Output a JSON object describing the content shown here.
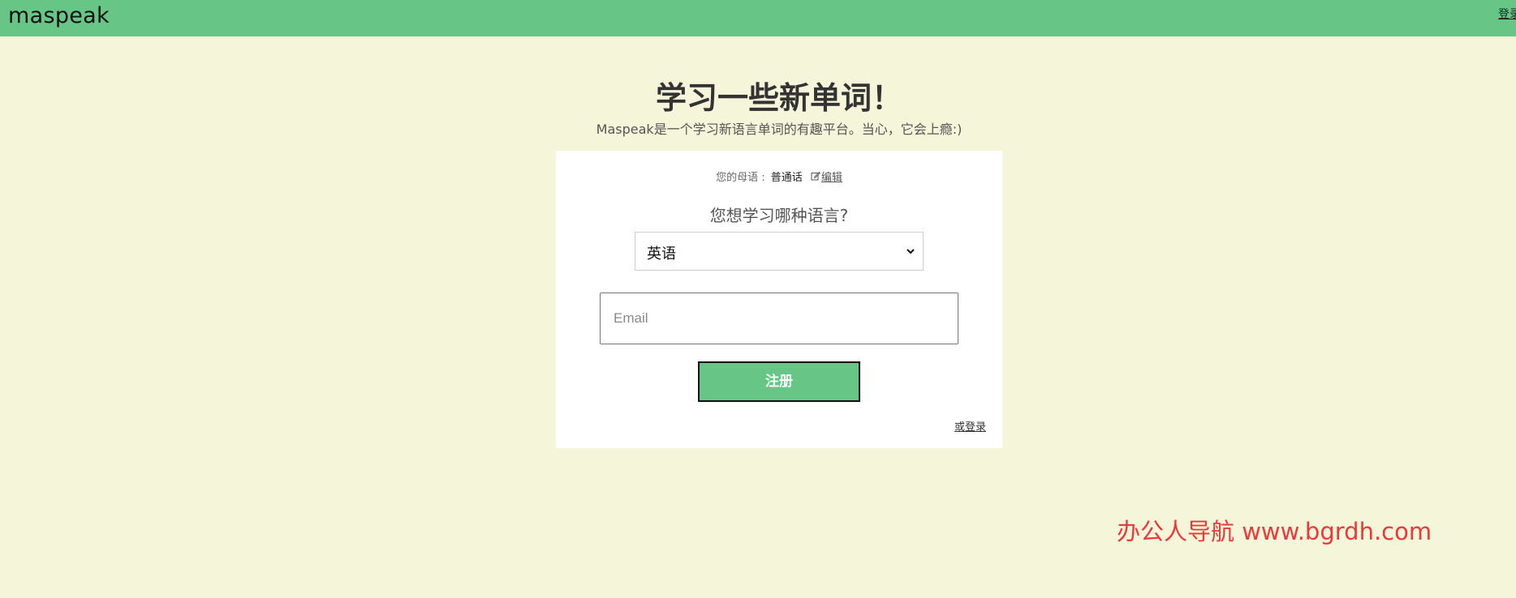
{
  "header": {
    "logo": "maspeak",
    "login_label": "登录"
  },
  "hero": {
    "title": "学习一些新单词！",
    "subtitle": "Maspeak是一个学习新语言单词的有趣平台。当心，它会上瘾:)"
  },
  "form": {
    "native_prefix": "您的母语 :",
    "native_language": "普通话",
    "edit_label": "编辑",
    "question": "您想学习哪种语言?",
    "selected_language": "英语",
    "email_placeholder": "Email",
    "email_value": "",
    "signup_label": "注册",
    "or_login_label": "或登录"
  },
  "watermark": "办公人导航 www.bgrdh.com",
  "colors": {
    "topbar": "#67c585",
    "background": "#f5f5da",
    "button": "#67c585",
    "watermark": "#e83a3a"
  },
  "icons": {
    "edit": "edit-icon",
    "select_caret": "chevron-down-icon"
  }
}
